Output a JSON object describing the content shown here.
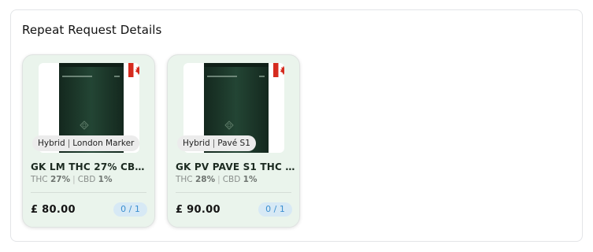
{
  "panel": {
    "title": "Repeat Request Details"
  },
  "products": [
    {
      "strain_type": "Hybrid",
      "strain_name": "London Marker",
      "name": "GK LM THC 27% CBD <...",
      "thc_label": "THC",
      "thc_value": "27%",
      "cbd_label": "CBD",
      "cbd_value": "1%",
      "price": "£ 80.00",
      "quantity": "0 / 1",
      "origin_flag": "canada-flag"
    },
    {
      "strain_type": "Hybrid",
      "strain_name": "Pavé S1",
      "name": "GK PV PAVE S1 THC 28...",
      "thc_label": "THC",
      "thc_value": "28%",
      "cbd_label": "CBD",
      "cbd_value": "1%",
      "price": "£ 90.00",
      "quantity": "0 / 1",
      "origin_flag": "canada-flag"
    }
  ],
  "colors": {
    "card_background": "#eaf4ec",
    "pouch": "#1f3a2c",
    "badge_background": "#d7e9f5",
    "badge_text": "#3b8fd0"
  }
}
